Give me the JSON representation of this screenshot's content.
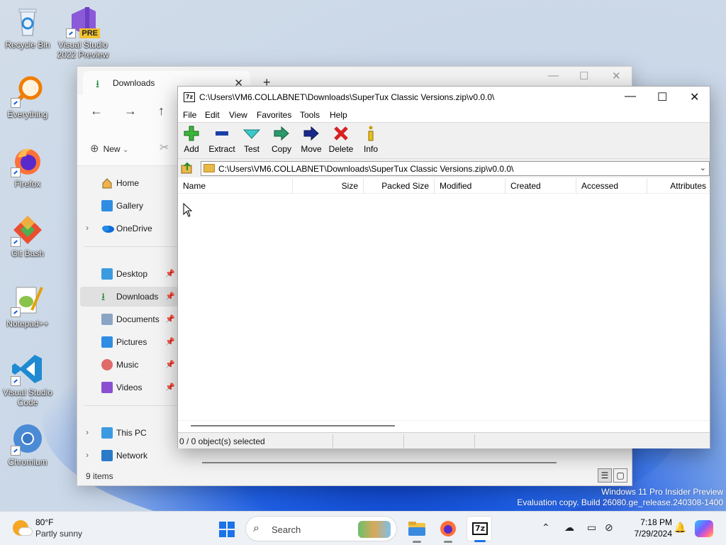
{
  "desktop": {
    "icons": [
      {
        "label": "Recycle Bin"
      },
      {
        "label": "Visual Studio 2022 Preview",
        "badge": "PRE"
      },
      {
        "label": "Everything"
      },
      {
        "label": "Firefox"
      },
      {
        "label": "Git Bash"
      },
      {
        "label": "Notepad++"
      },
      {
        "label": "Visual Studio Code"
      },
      {
        "label": "Chromium"
      }
    ],
    "watermark_line1": "Windows 11 Pro Insider Preview",
    "watermark_line2": "Evaluation copy. Build 26080.ge_release.240308-1400"
  },
  "explorer": {
    "tab_title": "Downloads",
    "new_label": "New",
    "sidebar": [
      {
        "label": "Home",
        "icon": "home-icon"
      },
      {
        "label": "Gallery",
        "icon": "gallery-icon"
      },
      {
        "label": "OneDrive",
        "icon": "onedrive-icon"
      },
      {
        "label": "Desktop",
        "icon": "desktop-icon"
      },
      {
        "label": "Downloads",
        "icon": "download-icon"
      },
      {
        "label": "Documents",
        "icon": "documents-icon"
      },
      {
        "label": "Pictures",
        "icon": "pictures-icon"
      },
      {
        "label": "Music",
        "icon": "music-icon"
      },
      {
        "label": "Videos",
        "icon": "videos-icon"
      },
      {
        "label": "This PC",
        "icon": "pc-icon"
      },
      {
        "label": "Network",
        "icon": "network-icon"
      }
    ],
    "status": "9 items"
  },
  "zip": {
    "title": "C:\\Users\\VM6.COLLABNET\\Downloads\\SuperTux Classic Versions.zip\\v0.0.0\\",
    "logo": "7z",
    "menu": [
      "File",
      "Edit",
      "View",
      "Favorites",
      "Tools",
      "Help"
    ],
    "toolbar": [
      "Add",
      "Extract",
      "Test",
      "Copy",
      "Move",
      "Delete",
      "Info"
    ],
    "address": "C:\\Users\\VM6.COLLABNET\\Downloads\\SuperTux Classic Versions.zip\\v0.0.0\\",
    "columns": [
      "Name",
      "Size",
      "Packed Size",
      "Modified",
      "Created",
      "Accessed",
      "Attributes"
    ],
    "status": "0 / 0 object(s) selected"
  },
  "taskbar": {
    "temperature": "80°F",
    "condition": "Partly sunny",
    "search_placeholder": "Search",
    "zip_app_label": "7z",
    "time": "7:18 PM",
    "date": "7/29/2024"
  },
  "colors": {
    "accent": "#1a73e8",
    "window_bg": "#f3f3f3",
    "toolbar_bg": "#f0f0f0"
  }
}
